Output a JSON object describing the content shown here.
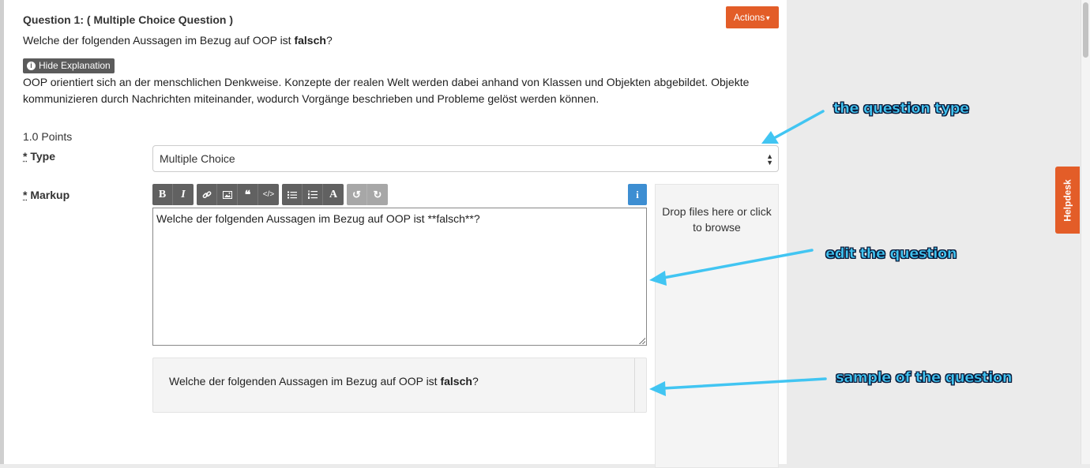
{
  "question": {
    "title": "Question 1: ( Multiple Choice Question )",
    "text_prefix": "Welche der folgenden Aussagen im Bezug auf OOP ist ",
    "text_bold": "falsch",
    "text_suffix": "?",
    "actions_label": "Actions",
    "hide_explanation_label": "Hide Explanation",
    "explanation": "OOP orientiert sich an der menschlichen Denkweise. Konzepte der realen Welt werden dabei anhand von Klassen und Objekten abgebildet. Objekte kommunizieren durch Nachrichten miteinander, wodurch Vorgänge beschrieben und Probleme gelöst werden können.",
    "points": "1.0 Points"
  },
  "form": {
    "type_label": "Type",
    "type_value": "Multiple Choice",
    "markup_label": "Markup",
    "required_marker": "*",
    "markup_value": "Welche der folgenden Aussagen im Bezug auf OOP ist **falsch**?",
    "dropzone_text": "Drop files here or click to browse",
    "preview_prefix": "Welche der folgenden Aussagen im Bezug auf OOP ist ",
    "preview_bold": "falsch",
    "preview_suffix": "?"
  },
  "toolbar": {
    "bold": "B",
    "italic": "I",
    "heading": "A",
    "info": "i"
  },
  "helpdesk_label": "Helpdesk",
  "annotations": {
    "question_type": "the question type",
    "edit_question": "edit the question",
    "sample_question": "sample of the question"
  },
  "colors": {
    "accent_orange": "#e35d28",
    "info_blue": "#3d8ed2",
    "annotation_cyan": "#41c5f2"
  }
}
